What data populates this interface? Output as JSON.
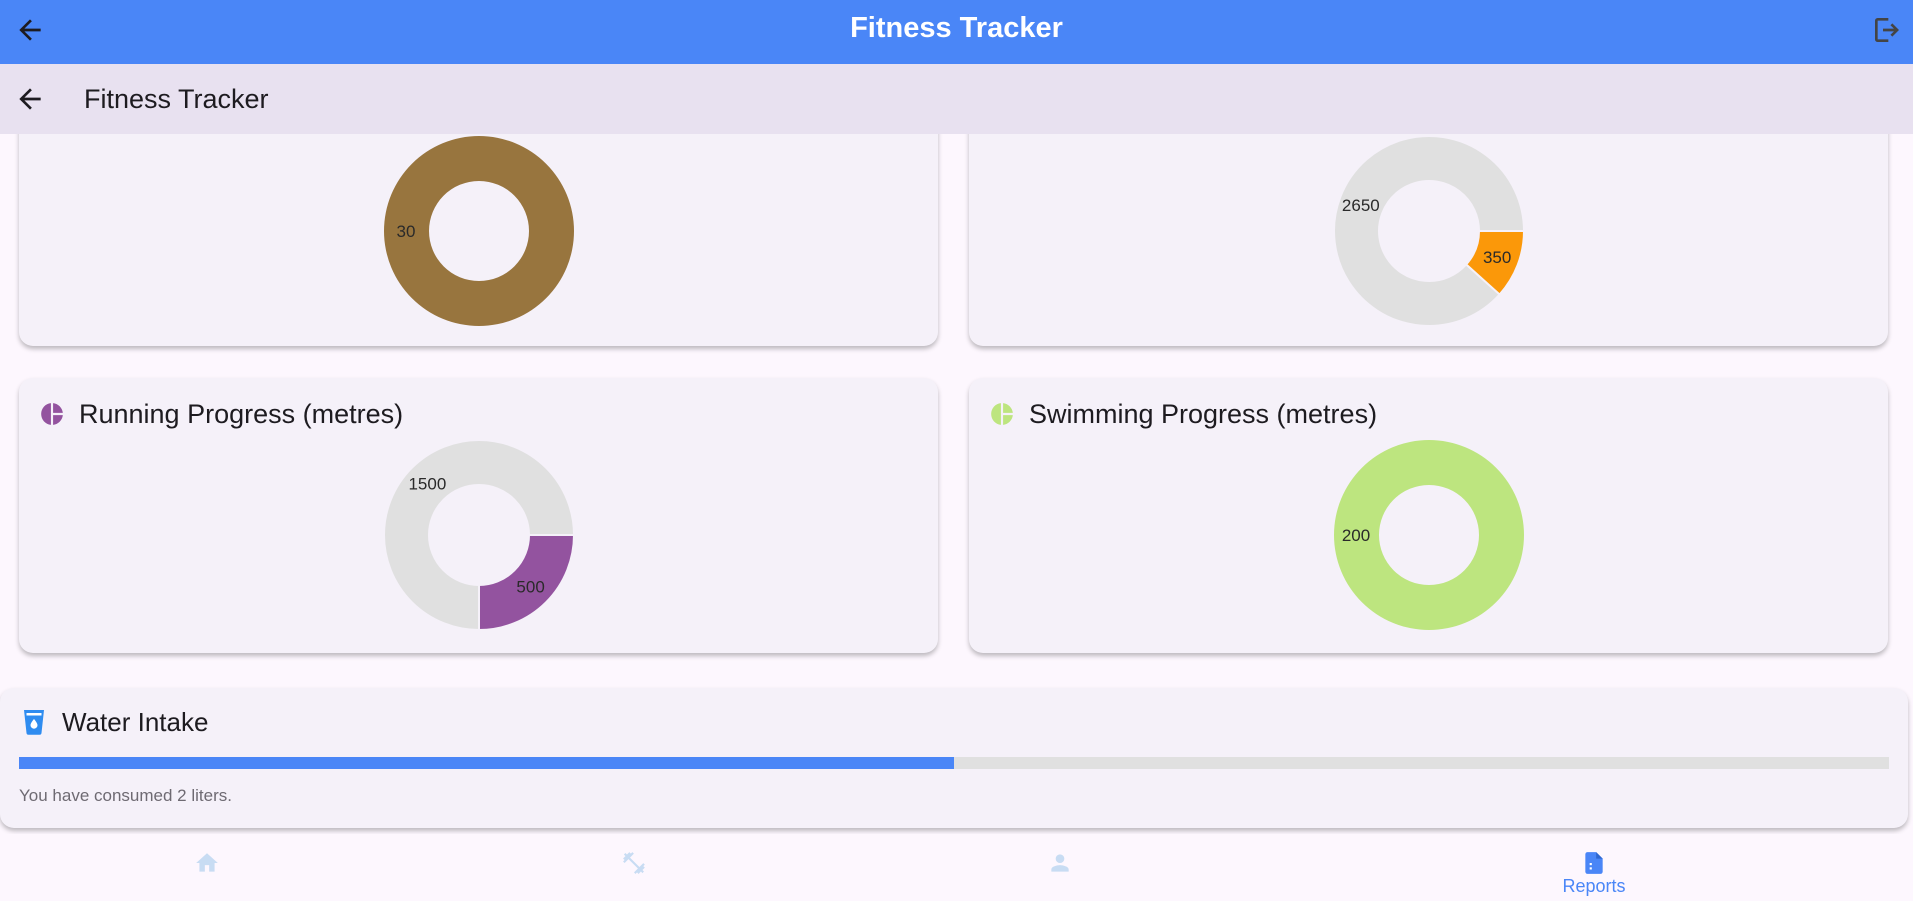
{
  "appbar": {
    "title": "Fitness Tracker",
    "back_icon": "arrow-back-icon",
    "logout_icon": "logout-icon"
  },
  "subbar": {
    "title": "Fitness Tracker",
    "back_icon": "arrow-back-icon"
  },
  "colors": {
    "primary": "#4a86f7",
    "card": "#f5f1f9",
    "remaining": "#e0e0e0"
  },
  "chart_data": [
    {
      "type": "pie",
      "title": "",
      "donut": true,
      "slices": [
        {
          "label": "30",
          "value": 30,
          "color": "#98753e"
        }
      ]
    },
    {
      "type": "pie",
      "title": "",
      "donut": true,
      "slices": [
        {
          "label": "350",
          "value": 350,
          "color": "#fb9809"
        },
        {
          "label": "2650",
          "value": 2650,
          "color": "#e0e0e0"
        }
      ]
    },
    {
      "type": "pie",
      "title": "Running Progress (metres)",
      "donut": true,
      "slices": [
        {
          "label": "500",
          "value": 500,
          "color": "#93539f"
        },
        {
          "label": "1500",
          "value": 1500,
          "color": "#e0e0e0"
        }
      ]
    },
    {
      "type": "pie",
      "title": "Swimming Progress (metres)",
      "donut": true,
      "slices": [
        {
          "label": "200",
          "value": 200,
          "color": "#bde57f"
        }
      ]
    }
  ],
  "cards": {
    "running": {
      "title": "Running Progress (metres)",
      "icon": "pie-chart-icon",
      "icon_color": "#93539f"
    },
    "swimming": {
      "title": "Swimming Progress (metres)",
      "icon": "pie-chart-icon",
      "icon_color": "#bde57f"
    }
  },
  "water": {
    "title": "Water Intake",
    "icon": "water-cup-icon",
    "message": "You have consumed 2 liters.",
    "progress": 0.5
  },
  "bottom_nav": [
    {
      "icon": "home-icon",
      "label": "",
      "active": false
    },
    {
      "icon": "dumbbell-icon",
      "label": "",
      "active": false
    },
    {
      "icon": "person-icon",
      "label": "",
      "active": false
    },
    {
      "icon": "reports-icon",
      "label": "Reports",
      "active": true
    }
  ]
}
